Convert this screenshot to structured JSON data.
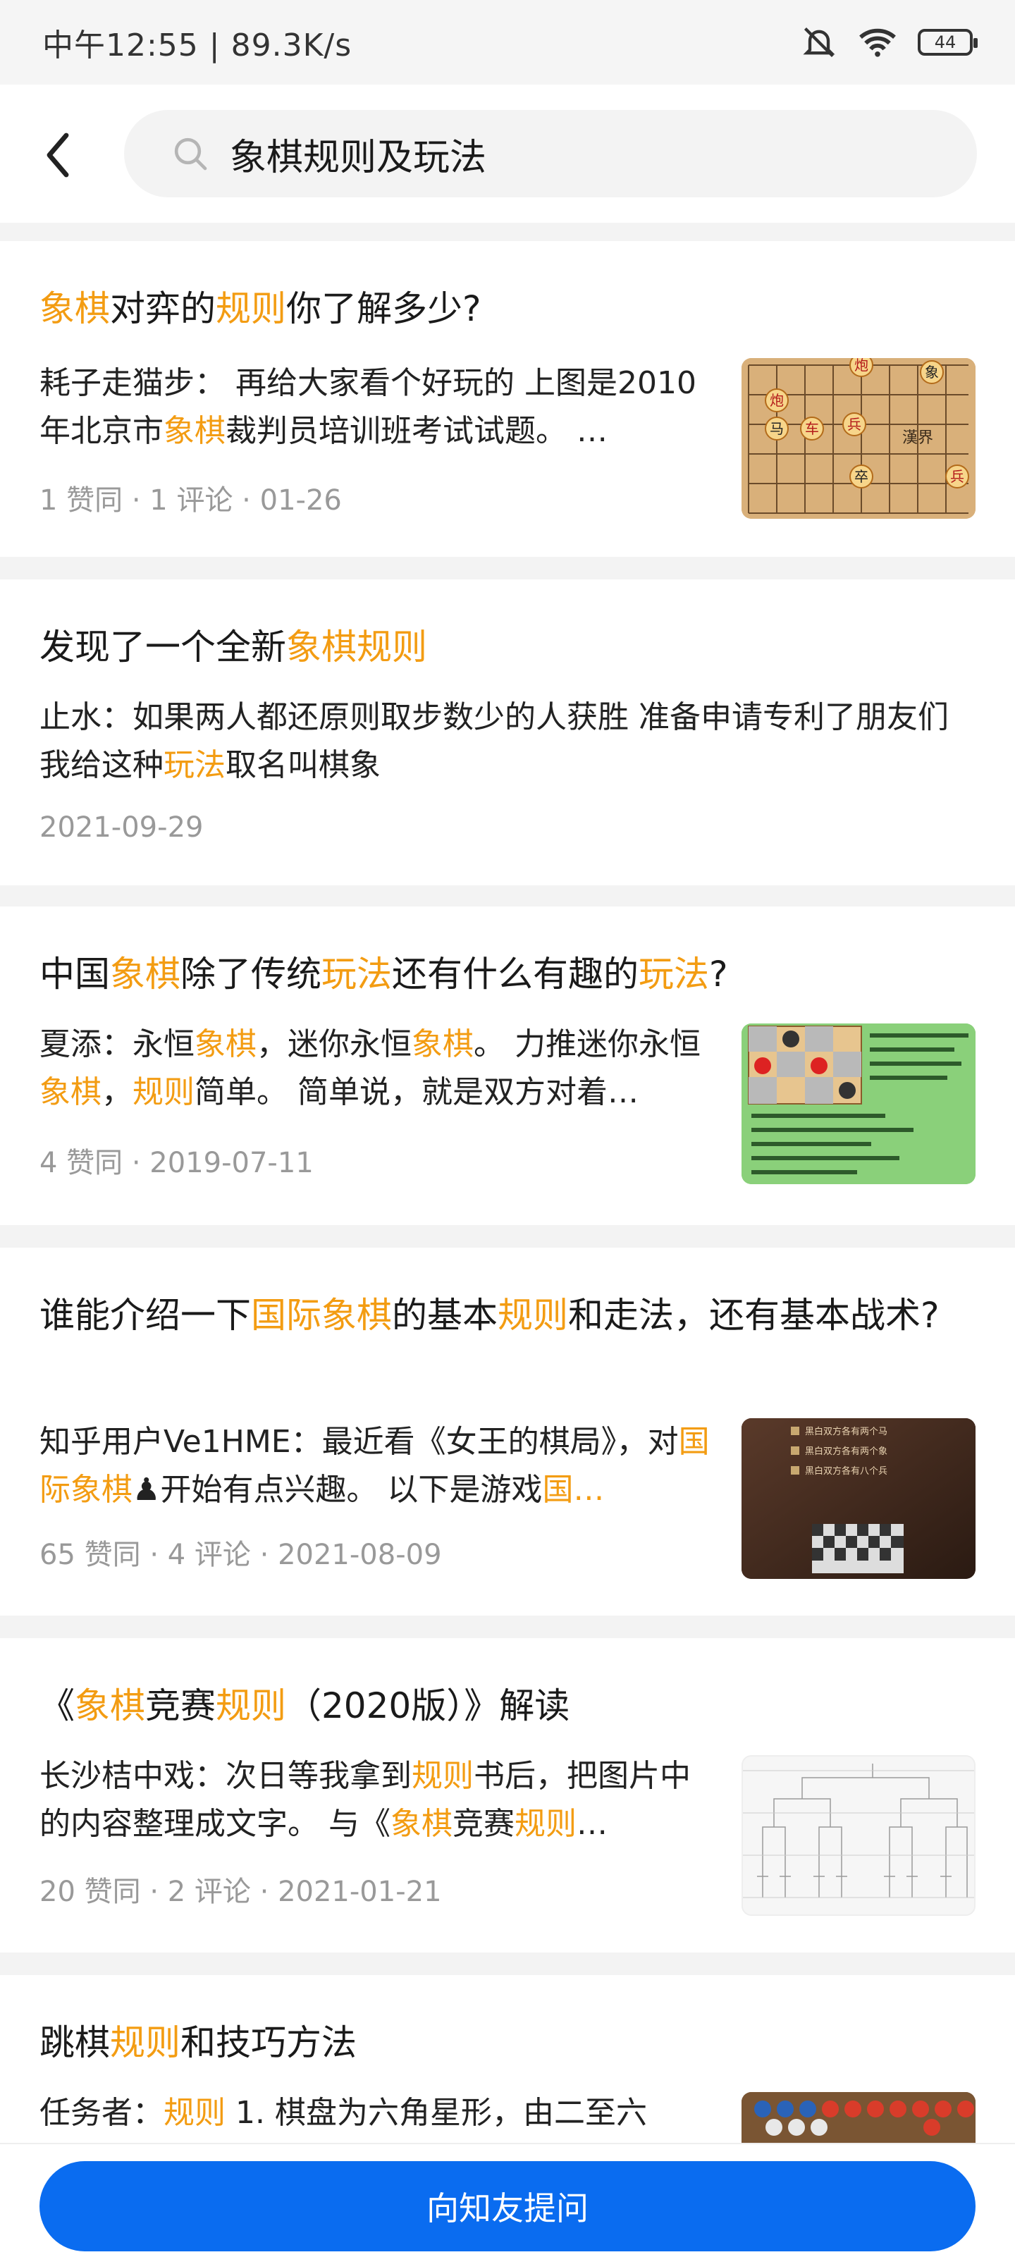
{
  "status": {
    "time_speed": "中午12:55 | 89.3K/s",
    "battery": "44"
  },
  "search": {
    "query": "象棋规则及玩法"
  },
  "results": [
    {
      "title": [
        {
          "t": "象棋",
          "hl": true
        },
        {
          "t": "对弈的",
          "hl": false
        },
        {
          "t": "规则",
          "hl": true
        },
        {
          "t": "你了解多少?",
          "hl": false
        }
      ],
      "excerpt": [
        {
          "t": "耗子走猫步： 再给大家看个好玩的 上图是2010年北京市",
          "hl": false
        },
        {
          "t": "象棋",
          "hl": true
        },
        {
          "t": "裁判员培训班考试试题。 …",
          "hl": false
        }
      ],
      "meta": "1 赞同 · 1 评论 · 01-26"
    },
    {
      "title": [
        {
          "t": "发现了一个全新",
          "hl": false
        },
        {
          "t": "象棋规则",
          "hl": true
        }
      ],
      "excerpt": [
        {
          "t": "止水：如果两人都还原则取步数少的人获胜 准备申请专利了朋友们 我给这种",
          "hl": false
        },
        {
          "t": "玩法",
          "hl": true
        },
        {
          "t": "取名叫棋象",
          "hl": false
        }
      ],
      "meta": "2021-09-29"
    },
    {
      "title": [
        {
          "t": "中国",
          "hl": false
        },
        {
          "t": "象棋",
          "hl": true
        },
        {
          "t": "除了传统",
          "hl": false
        },
        {
          "t": "玩法",
          "hl": true
        },
        {
          "t": "还有什么有趣的",
          "hl": false
        },
        {
          "t": "玩法",
          "hl": true
        },
        {
          "t": "?",
          "hl": false
        }
      ],
      "excerpt": [
        {
          "t": "夏添：永恒",
          "hl": false
        },
        {
          "t": "象棋",
          "hl": true
        },
        {
          "t": "，迷你永恒",
          "hl": false
        },
        {
          "t": "象棋",
          "hl": true
        },
        {
          "t": "。 力推迷你永恒",
          "hl": false
        },
        {
          "t": "象棋",
          "hl": true
        },
        {
          "t": "，",
          "hl": false
        },
        {
          "t": "规则",
          "hl": true
        },
        {
          "t": "简单。 简单说，就是双方对着…",
          "hl": false
        }
      ],
      "meta": "4 赞同 · 2019-07-11"
    },
    {
      "title": [
        {
          "t": "谁能介绍一下",
          "hl": false
        },
        {
          "t": "国际象棋",
          "hl": true
        },
        {
          "t": "的基本",
          "hl": false
        },
        {
          "t": "规则",
          "hl": true
        },
        {
          "t": "和走法，还有基本战术?",
          "hl": false
        }
      ],
      "excerpt": [
        {
          "t": "知乎用户Ve1HME：最近看《女王的棋局》，对",
          "hl": false
        },
        {
          "t": "国际象棋",
          "hl": true
        },
        {
          "t": "♟开始有点兴趣。 以下是游戏",
          "hl": false
        },
        {
          "t": "国…",
          "hl": true
        }
      ],
      "meta": "65 赞同 · 4 评论 · 2021-08-09"
    },
    {
      "title": [
        {
          "t": "《",
          "hl": false
        },
        {
          "t": "象棋",
          "hl": true
        },
        {
          "t": "竞赛",
          "hl": false
        },
        {
          "t": "规则",
          "hl": true
        },
        {
          "t": "（2020版）》解读",
          "hl": false
        }
      ],
      "excerpt": [
        {
          "t": "长沙桔中戏：次日等我拿到",
          "hl": false
        },
        {
          "t": "规则",
          "hl": true
        },
        {
          "t": "书后，把图片中的内容整理成文字。 与《",
          "hl": false
        },
        {
          "t": "象棋",
          "hl": true
        },
        {
          "t": "竞赛",
          "hl": false
        },
        {
          "t": "规则",
          "hl": true
        },
        {
          "t": "…",
          "hl": false
        }
      ],
      "meta": "20 赞同 · 2 评论 · 2021-01-21"
    },
    {
      "title": [
        {
          "t": "跳棋",
          "hl": false
        },
        {
          "t": "规则",
          "hl": true
        },
        {
          "t": "和技巧方法",
          "hl": false
        }
      ],
      "excerpt": [
        {
          "t": "任务者：",
          "hl": false
        },
        {
          "t": "规则",
          "hl": true
        },
        {
          "t": " 1.  棋盘为六角星形，由二至六",
          "hl": false
        }
      ],
      "meta": ""
    }
  ],
  "thumbs": {
    "t1_text": [
      "炮",
      "炮",
      "象",
      "兵",
      "马",
      "卒",
      "车",
      "兵",
      "漢界",
      "兵"
    ],
    "t4_rows": [
      "黑白双方各有两个马",
      "黑白双方各有两个象",
      "黑白双方各有八个兵"
    ]
  },
  "ask_button": "向知友提问"
}
